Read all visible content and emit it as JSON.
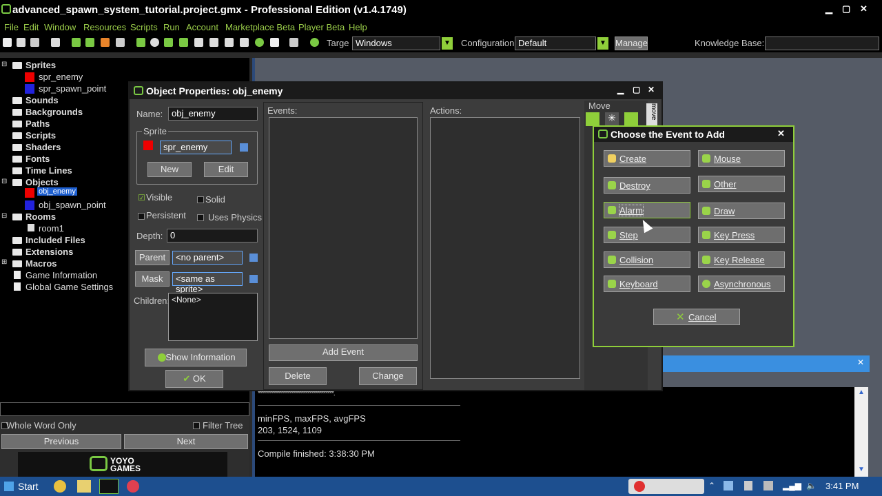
{
  "window": {
    "title": "advanced_spawn_system_tutorial.project.gmx  -  Professional Edition (v1.4.1749)"
  },
  "menu": [
    "File",
    "Edit",
    "Window",
    "Resources",
    "Scripts",
    "Run",
    "Account",
    "Marketplace Beta",
    "Player Beta",
    "Help"
  ],
  "toolbar": {
    "target_label": "Targe",
    "target_value": "Windows",
    "config_label": "Configuration:",
    "config_value": "Default",
    "manage_label": "Manage",
    "kb_label": "Knowledge Base:"
  },
  "tree": {
    "sprites": "Sprites",
    "spr_enemy": "spr_enemy",
    "spr_spawn_point": "spr_spawn_point",
    "sounds": "Sounds",
    "backgrounds": "Backgrounds",
    "paths": "Paths",
    "scripts": "Scripts",
    "shaders": "Shaders",
    "fonts": "Fonts",
    "time_lines": "Time Lines",
    "objects": "Objects",
    "obj_enemy": "obj_enemy",
    "obj_spawn_point": "obj_spawn_point",
    "rooms": "Rooms",
    "room1": "room1",
    "included_files": "Included Files",
    "extensions": "Extensions",
    "macros": "Macros",
    "game_information": "Game Information",
    "global_game_settings": "Global Game Settings"
  },
  "search": {
    "whole_word": "Whole Word Only",
    "filter_tree": "Filter Tree",
    "previous": "Previous",
    "next": "Next",
    "logo_text": "YOYO GAMES"
  },
  "objprops": {
    "title": "Object Properties: obj_enemy",
    "name_label": "Name:",
    "name_value": "obj_enemy",
    "sprite_group": "Sprite",
    "sprite_value": "spr_enemy",
    "new_label": "New",
    "edit_label": "Edit",
    "visible": "Visible",
    "solid": "Solid",
    "persistent": "Persistent",
    "uses_physics": "Uses Physics",
    "depth_label": "Depth:",
    "depth_value": "0",
    "parent_label": "Parent",
    "parent_value": "<no parent>",
    "mask_label": "Mask",
    "mask_value": "<same as sprite>",
    "children_label": "Children:",
    "children_value": "<None>",
    "show_info": "Show Information",
    "ok": "OK",
    "events_label": "Events:",
    "actions_label": "Actions:",
    "add_event": "Add Event",
    "delete": "Delete",
    "change": "Change",
    "move_tab": "Move",
    "side_tab": "move"
  },
  "events": {
    "title": "Choose the Event to Add",
    "create": "Create",
    "mouse": "Mouse",
    "destroy": "Destroy",
    "other": "Other",
    "alarm": "Alarm",
    "draw": "Draw",
    "step": "Step",
    "key_press": "Key Press",
    "collision": "Collision",
    "key_release": "Key Release",
    "keyboard": "Keyboard",
    "asynchronous": "Asynchronous",
    "cancel": "Cancel"
  },
  "output": {
    "stars": "**************************************.",
    "fps_header": "minFPS, maxFPS, avgFPS",
    "fps_values": "203, 1524, 1109",
    "compile": "Compile finished: 3:38:30 PM"
  },
  "taskbar": {
    "start": "Start",
    "clock": "3:41 PM"
  },
  "colors": {
    "accent": "#8fcf3a",
    "menu_text": "#9ccf4a",
    "selection": "#1d5fd0",
    "taskbar": "#1d4f8f"
  }
}
